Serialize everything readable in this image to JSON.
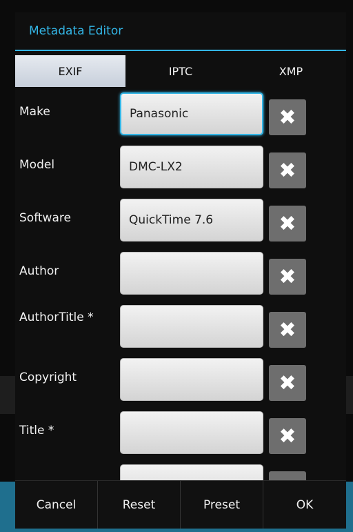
{
  "dialog": {
    "title": "Metadata Editor"
  },
  "tabs": [
    {
      "label": "EXIF",
      "active": true
    },
    {
      "label": "IPTC",
      "active": false
    },
    {
      "label": "XMP",
      "active": false
    }
  ],
  "fields": [
    {
      "label": "Make",
      "value": "Panasonic"
    },
    {
      "label": "Model",
      "value": "DMC-LX2"
    },
    {
      "label": "Software",
      "value": "QuickTime 7.6"
    },
    {
      "label": "Author",
      "value": ""
    },
    {
      "label": "AuthorTitle *",
      "value": ""
    },
    {
      "label": "Copyright",
      "value": ""
    },
    {
      "label": "Title *",
      "value": ""
    }
  ],
  "clear_icon_glyph": "✖",
  "footer": {
    "cancel": "Cancel",
    "reset": "Reset",
    "preset": "Preset",
    "ok": "OK"
  },
  "colors": {
    "accent": "#33b5e5"
  }
}
